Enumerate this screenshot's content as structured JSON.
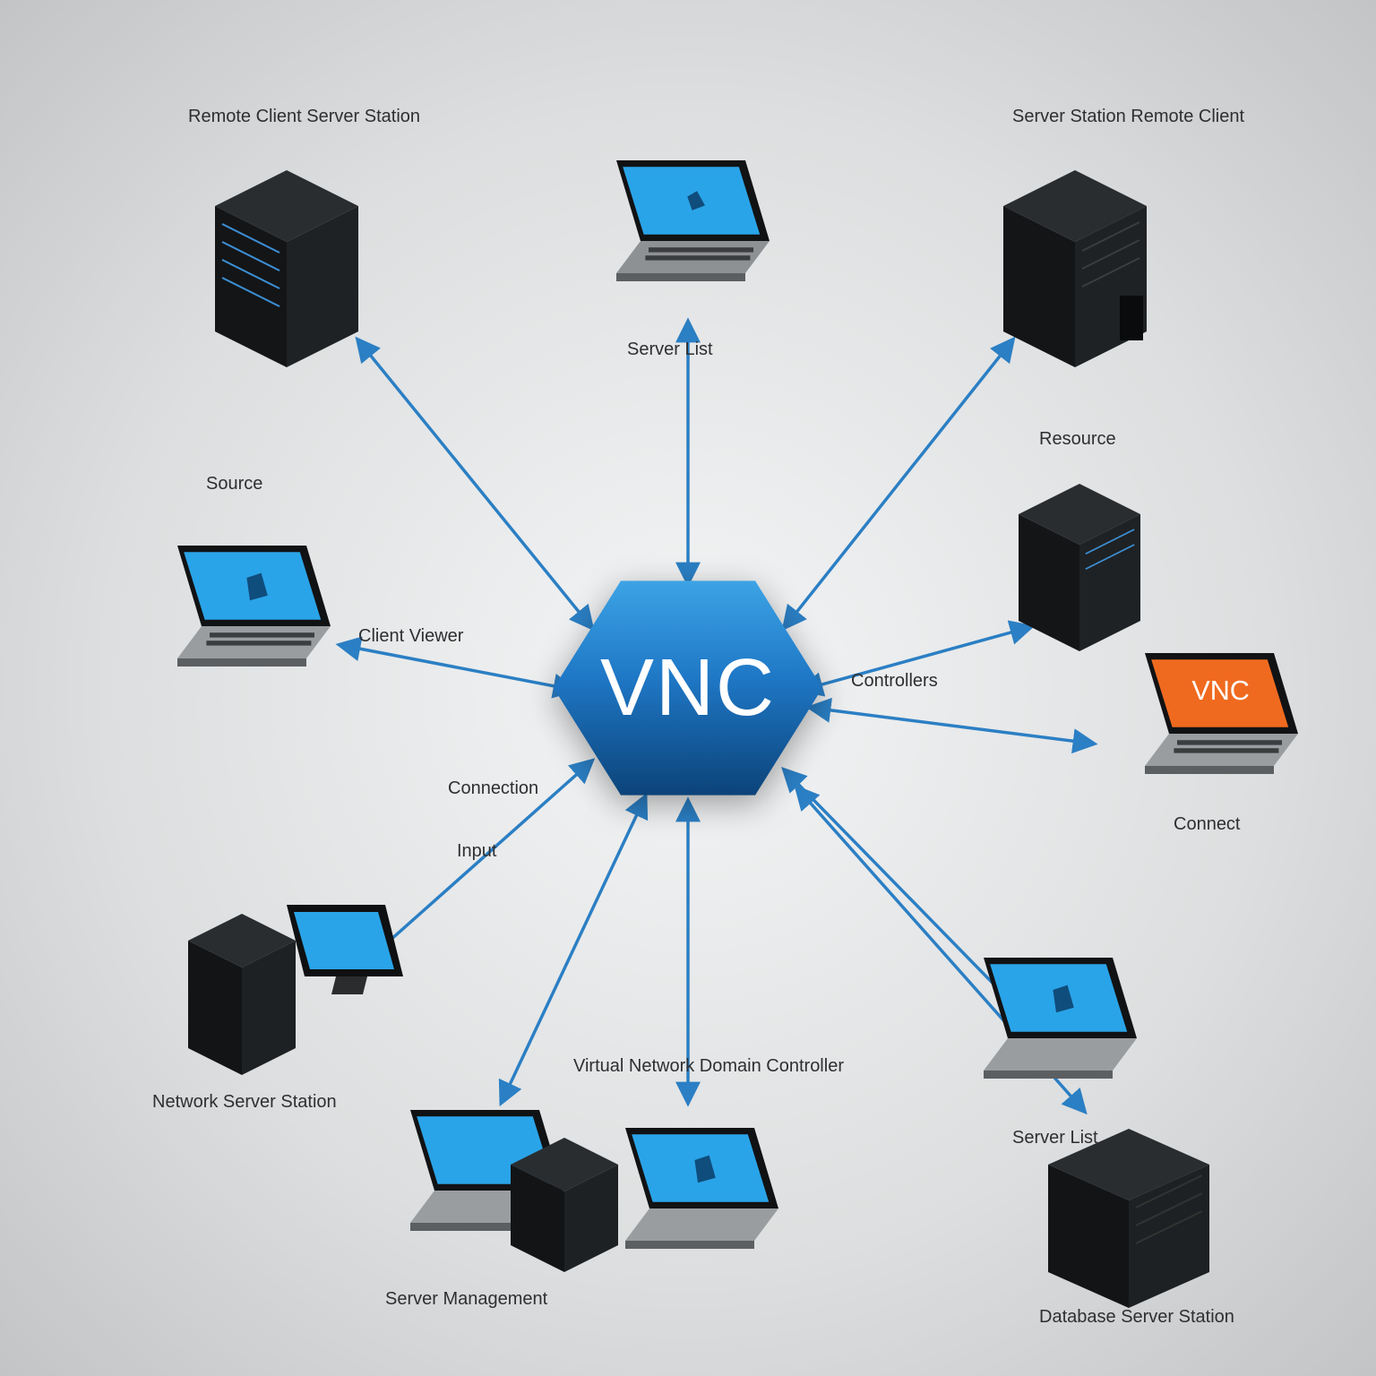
{
  "center": {
    "label": "VNC"
  },
  "nodes": {
    "top_left_server": {
      "label1": "Remote Client",
      "label2": "Server Station"
    },
    "top_laptop": {
      "label1": "Server List",
      "label2": ""
    },
    "top_right_server": {
      "label1": "Server Station",
      "label2": "Remote Client"
    },
    "mid_left_laptop": {
      "label1": "Source",
      "label2": ""
    },
    "mid_right_server": {
      "label1": "Resource",
      "label2": ""
    },
    "label_viewer": {
      "text": "Client Viewer"
    },
    "label_controllers": {
      "text": "Controllers"
    },
    "label_connect": {
      "text": "Connection"
    },
    "vnc_laptop": {
      "badge": "VNC",
      "label1": "Connect",
      "label2": ""
    },
    "label_input": {
      "text": "Input"
    },
    "left_server": {
      "label1": "Network",
      "label2": "Server Station"
    },
    "bottom_laptop_l": {
      "label1": "Server",
      "label2": "Management"
    },
    "label_domain": {
      "text1": "Virtual Network Domain",
      "text2": "Controller"
    },
    "bottom_laptop_c": {
      "label1": "",
      "label2": ""
    },
    "bottom_right_box": {
      "label1": "Database",
      "label2": "Server Station"
    },
    "lower_right_laptop": {
      "label1": "Server List",
      "label2": ""
    }
  },
  "colors": {
    "arrow": "#2b7fc4",
    "screen_blue": "#2aa4e8",
    "screen_orange": "#ef6a1f",
    "box_dark": "#1b1d1f",
    "box_mid": "#2a2d30",
    "metal": "#b9bcbf"
  }
}
